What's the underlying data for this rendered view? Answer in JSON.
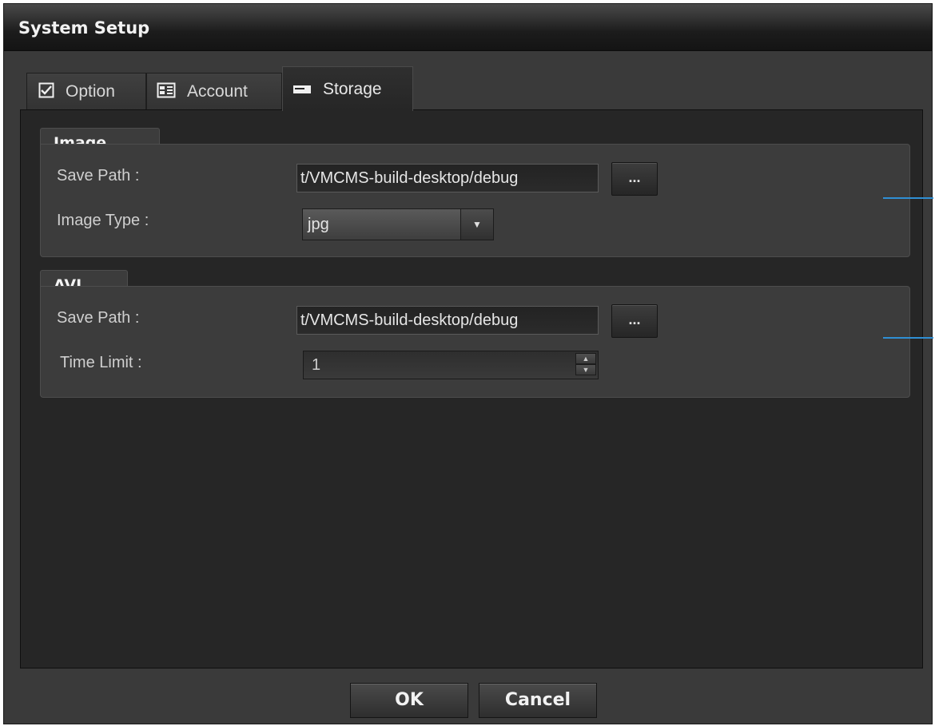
{
  "window": {
    "title": "System Setup"
  },
  "tabs": [
    {
      "label": "Option",
      "icon": "checkbox-icon"
    },
    {
      "label": "Account",
      "icon": "account-icon"
    },
    {
      "label": "Storage",
      "icon": "storage-icon",
      "active": true
    }
  ],
  "image_group": {
    "title": "Image",
    "save_path_label": "Save Path :",
    "save_path_value": "t/VMCMS-build-desktop/debug",
    "browse_label": "...",
    "image_type_label": "Image Type :",
    "image_type_value": "jpg"
  },
  "avi_group": {
    "title": "AVI",
    "save_path_label": "Save Path :",
    "save_path_value": "t/VMCMS-build-desktop/debug",
    "browse_label": "...",
    "time_limit_label": "Time Limit :",
    "time_limit_value": "1"
  },
  "buttons": {
    "ok": "OK",
    "cancel": "Cancel"
  },
  "colors": {
    "accent_line": "#2f8fd4"
  }
}
